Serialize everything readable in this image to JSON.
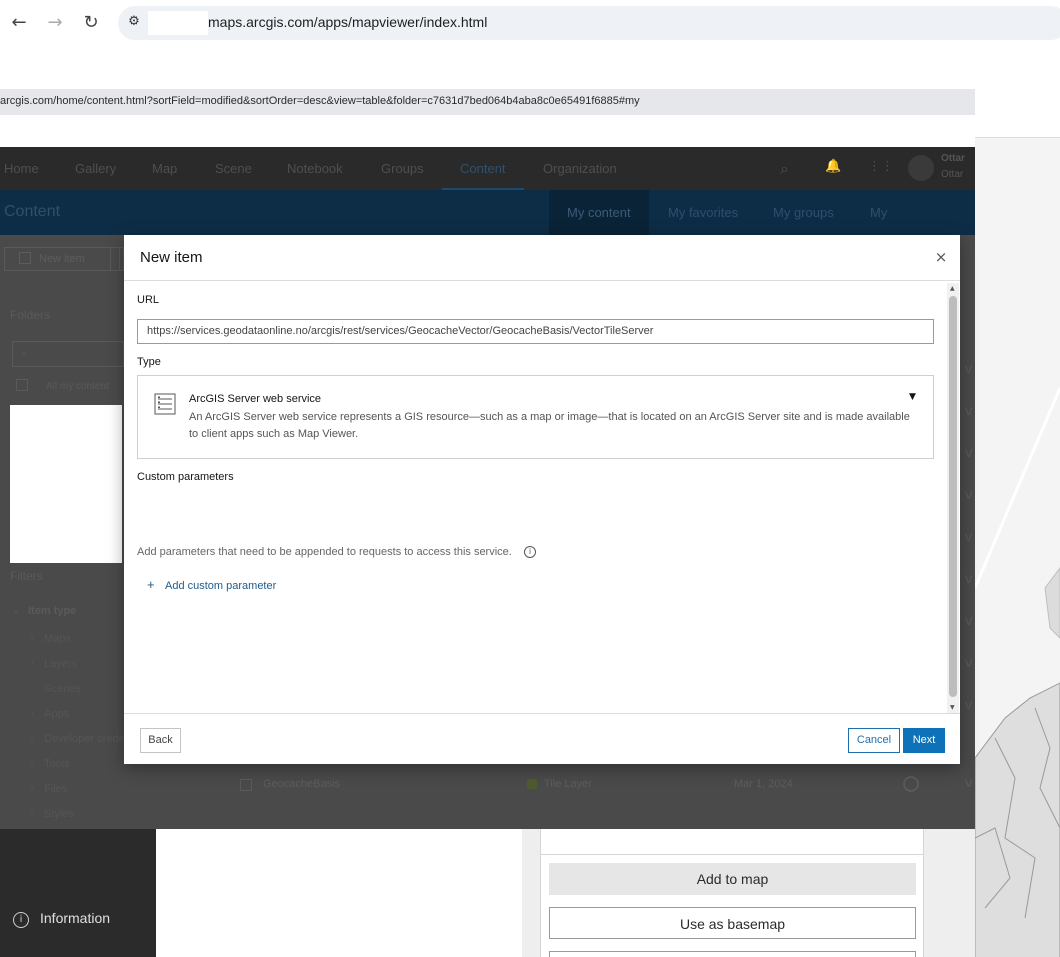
{
  "browser": {
    "back_icon": "←",
    "forward_icon": "→",
    "reload_icon": "↻",
    "site_info_icon": "⚙",
    "url": "maps.arcgis.com/apps/mapviewer/index.html",
    "secondary_url": "arcgis.com/home/content.html?sortField=modified&sortOrder=desc&view=table&folder=c7631d7bed064b4aba8c0e65491f6885#my"
  },
  "arcgis": {
    "nav": [
      "Home",
      "Gallery",
      "Map",
      "Scene",
      "Notebook",
      "Groups",
      "Content",
      "Organization"
    ],
    "active_nav": "Content",
    "user_name": "Ottar",
    "user_sub": "Ottar",
    "icons": {
      "search": "⌕",
      "bell": "🔔",
      "apps": "⋮⋮"
    },
    "band_title": "Content",
    "tabs": [
      "My content",
      "My favorites",
      "My groups",
      "My organization"
    ],
    "new_item_label": "New item",
    "folders_label": "Folders",
    "search_icon": "⌕",
    "all_my_content": "All my content",
    "filters_label": "Filters",
    "item_type_label": "Item type",
    "filter_items": [
      "Maps",
      "Layers",
      "Scenes",
      "Apps",
      "Developer credentials",
      "Tools",
      "Files",
      "Styles"
    ],
    "row": {
      "title": "GeocacheBasis",
      "type": "Tile Layer",
      "date": "Mar 1, 2024"
    },
    "right_col_letters": [
      "V",
      "V",
      "V",
      "V",
      "V",
      "V",
      "V",
      "V",
      "V",
      "V"
    ]
  },
  "mapviewer": {
    "information_label": "Information",
    "add_to_map": "Add to map",
    "use_as_basemap": "Use as basemap"
  },
  "modal": {
    "title": "New item",
    "close_icon": "×",
    "url_label": "URL",
    "url_value": "https://services.geodataonline.no/arcgis/rest/services/GeocacheVector/GeocacheBasis/VectorTileServer",
    "type_label": "Type",
    "type_name": "ArcGIS Server web service",
    "type_desc": "An ArcGIS Server web service represents a GIS resource—such as a map or image—that is located on an ArcGIS Server site and is made available to client apps such as Map Viewer.",
    "custom_params_label": "Custom parameters",
    "custom_params_help": "Add parameters that need to be appended to requests to access this service.",
    "add_param_label": "Add custom parameter",
    "back_label": "Back",
    "cancel_label": "Cancel",
    "next_label": "Next"
  },
  "colors": {
    "accent": "#0d72b8",
    "link": "#1f5c8c",
    "overlay": "#4a4a4a"
  }
}
